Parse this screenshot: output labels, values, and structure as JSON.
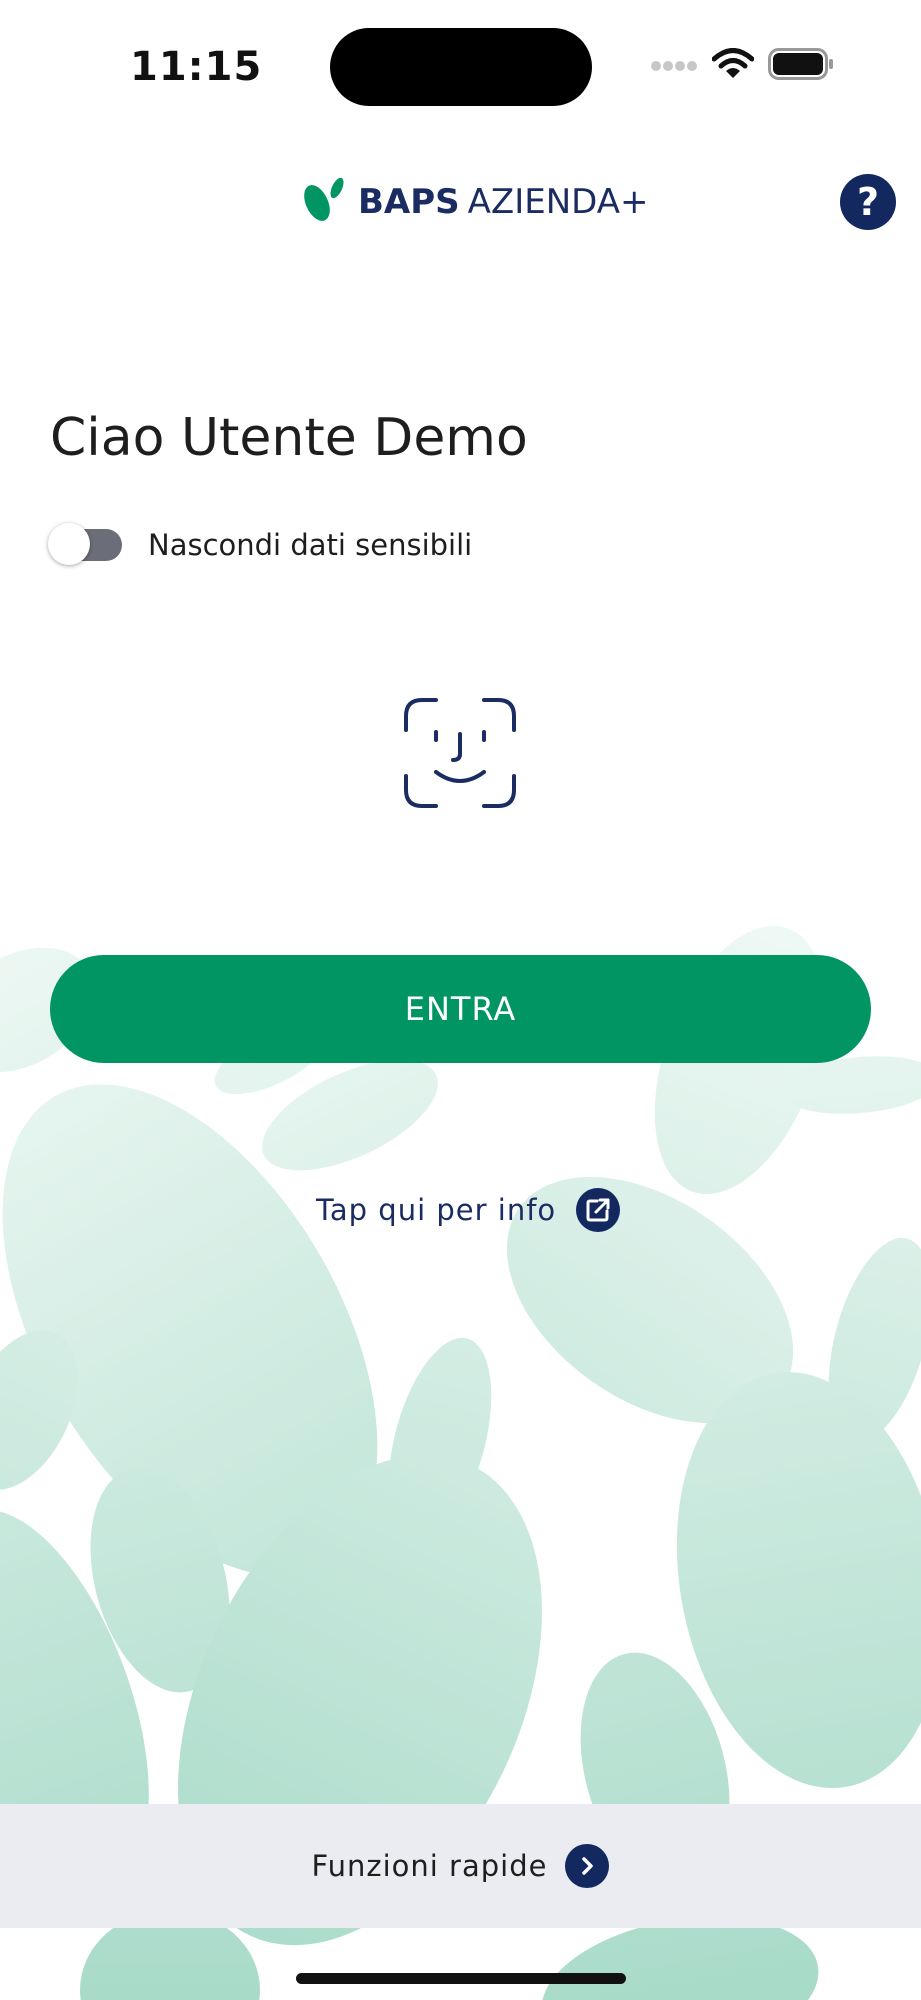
{
  "status_bar": {
    "time": "11:15"
  },
  "header": {
    "logo_bold": "BAPS",
    "logo_light": "AZIENDA+",
    "help_label": "?"
  },
  "greeting": "Ciao Utente Demo",
  "privacy_toggle": {
    "label": "Nascondi dati sensibili",
    "on": false
  },
  "login": {
    "button_label": "ENTRA"
  },
  "info_link": {
    "label": "Tap qui per info"
  },
  "quick_bar": {
    "label": "Funzioni rapide"
  },
  "colors": {
    "primary_green": "#009563",
    "navy": "#12285f",
    "background_leaf": "#b4dfd0",
    "quick_bar_bg": "#eaecf1"
  },
  "icons": [
    "wifi-icon",
    "battery-icon",
    "help-icon",
    "face-id-icon",
    "external-link-icon",
    "chevron-right-icon"
  ]
}
